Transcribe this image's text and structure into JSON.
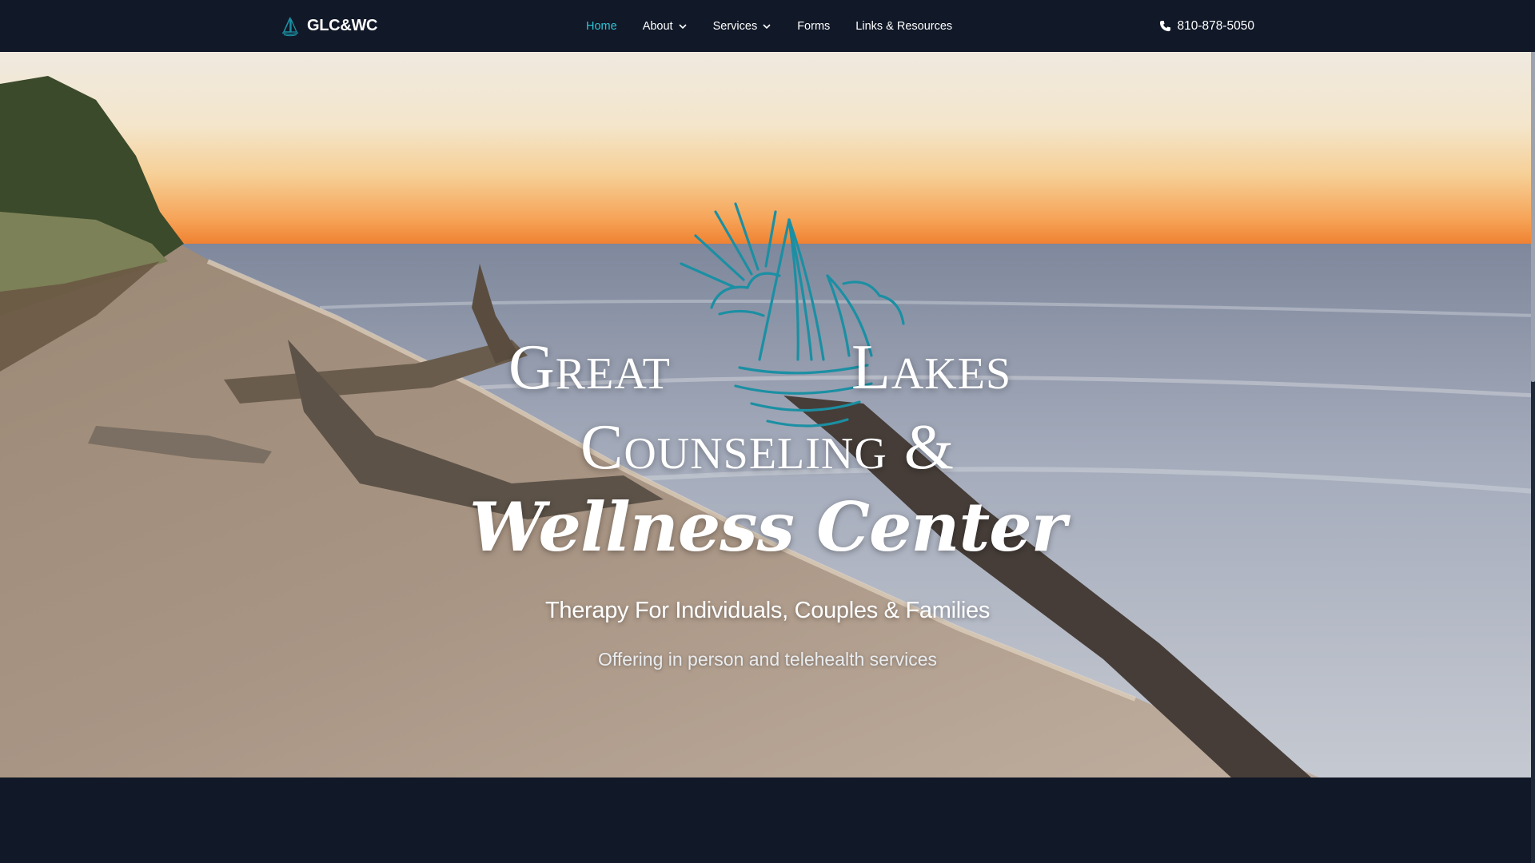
{
  "nav": {
    "brand": "GLC&WC",
    "items": [
      {
        "label": "Home",
        "active": true,
        "dropdown": false
      },
      {
        "label": "About",
        "active": false,
        "dropdown": true
      },
      {
        "label": "Services",
        "active": false,
        "dropdown": true
      },
      {
        "label": "Forms",
        "active": false,
        "dropdown": false
      },
      {
        "label": "Links & Resources",
        "active": false,
        "dropdown": false
      }
    ],
    "phone": "810-878-5050",
    "icons": {
      "brand": "sailboat-logo-icon",
      "dropdown": "chevron-down-icon",
      "phone": "phone-icon"
    }
  },
  "hero": {
    "title_great": "Great",
    "title_lakes": "Lakes",
    "title_counseling": "Counseling &",
    "title_wellness": "Wellness Center",
    "subtitle": "Therapy For Individuals, Couples & Families",
    "tagline": "Offering in person and telehealth services",
    "logo_icon": "sailboat-sun-logo-icon"
  },
  "colors": {
    "nav_background": "#111827",
    "active_link": "#2ec4d6",
    "logo_teal": "#1b8fa3",
    "footer_background": "#111827"
  }
}
